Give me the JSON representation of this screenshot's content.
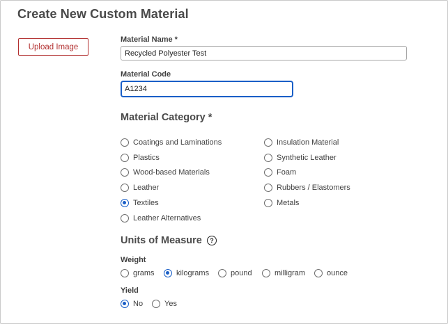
{
  "page": {
    "title": "Create New Custom Material"
  },
  "upload_button": {
    "label": "Upload Image"
  },
  "material_name": {
    "label": "Material Name *",
    "value": "Recycled Polyester Test"
  },
  "material_code": {
    "label": "Material Code",
    "value": "A1234"
  },
  "category": {
    "heading": "Material Category *",
    "selected": "Textiles",
    "left_options": [
      "Coatings and Laminations",
      "Plastics",
      "Wood-based Materials",
      "Leather",
      "Textiles",
      "Leather Alternatives"
    ],
    "right_options": [
      "Insulation Material",
      "Synthetic Leather",
      "Foam",
      "Rubbers / Elastomers",
      "Metals"
    ]
  },
  "units": {
    "heading": "Units of Measure",
    "help_icon": "?",
    "weight": {
      "label": "Weight",
      "selected": "kilograms",
      "options": [
        "grams",
        "kilograms",
        "pound",
        "milligram",
        "ounce"
      ]
    },
    "yield": {
      "label": "Yield",
      "selected": "No",
      "options": [
        "No",
        "Yes"
      ]
    }
  },
  "colors": {
    "accent": "#1a5fc7",
    "button_red": "#b22f2f"
  },
  "icons": {
    "help": "question-circle-icon"
  }
}
